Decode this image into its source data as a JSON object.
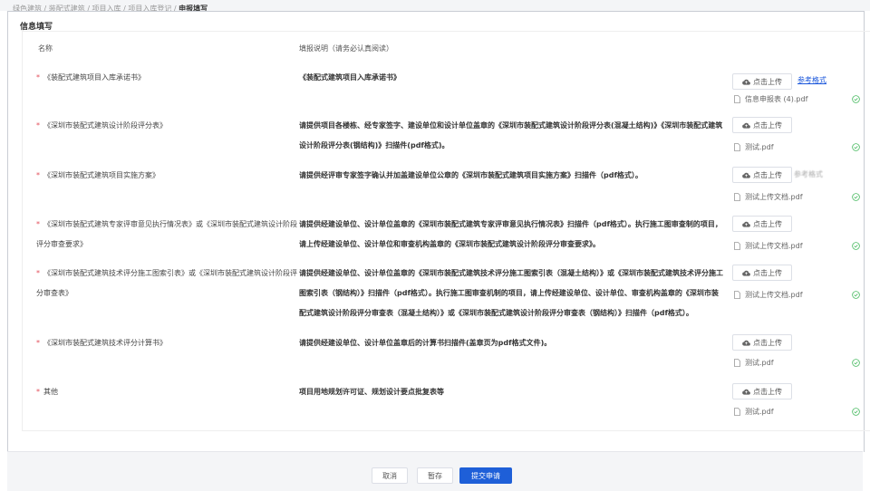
{
  "breadcrumb": {
    "path": "绿色建筑 / 装配式建筑 / 项目入库 / 项目入库登记 / ",
    "current": "申报填写"
  },
  "section_title": "信息填写",
  "table": {
    "headers": {
      "name": "名称",
      "desc": "填报说明（请务必认真阅读）"
    },
    "rows": [
      {
        "required": "*",
        "name": "《装配式建筑项目入库承诺书》",
        "desc": "《装配式建筑项目入库承诺书》",
        "upload_label": "点击上传",
        "link": "参考格式",
        "file": "信息申报表 (4).pdf"
      },
      {
        "required": "*",
        "name": "《深圳市装配式建筑设计阶段评分表》",
        "desc": "请提供项目各楼栋、经专家签字、建设单位和设计单位盖章的《深圳市装配式建筑设计阶段评分表(混凝土结构)》《深圳市装配式建筑设计阶段评分表(钢结构)》扫描件(pdf格式)。",
        "upload_label": "点击上传",
        "file": "测试.pdf"
      },
      {
        "required": "*",
        "name": "《深圳市装配式建筑项目实施方案》",
        "desc": "请提供经评审专家签字确认并加盖建设单位公章的《深圳市装配式建筑项目实施方案》扫描件（pdf格式）。",
        "upload_label": "点击上传",
        "link_blurred": "参考格式",
        "file": "测试上传文档.pdf"
      },
      {
        "required": "*",
        "name": "《深圳市装配式建筑专家评审意见执行情况表》或《深圳市装配式建筑设计阶段评分审查要求》",
        "desc": "请提供经建设单位、设计单位盖章的《深圳市装配式建筑专家评审意见执行情况表》扫描件（pdf格式）。执行施工图审查制的项目，请上传经建设单位、设计单位和审查机构盖章的《深圳市装配式建筑设计阶段评分审查要求》。",
        "upload_label": "点击上传",
        "file": "测试上传文档.pdf"
      },
      {
        "required": "*",
        "name": "《深圳市装配式建筑技术评分施工图索引表》或《深圳市装配式建筑设计阶段评分审查表》",
        "desc": "请提供经建设单位、设计单位盖章的《深圳市装配式建筑技术评分施工图索引表（混凝土结构）》或《深圳市装配式建筑技术评分施工图索引表（钢结构）》扫描件（pdf格式）。执行施工图审查机制的项目，请上传经建设单位、设计单位、审查机构盖章的《深圳市装配式建筑设计阶段评分审查表（混凝土结构）》或《深圳市装配式建筑设计阶段评分审查表（钢结构）》扫描件（pdf格式）。",
        "upload_label": "点击上传",
        "file": "测试上传文档.pdf"
      },
      {
        "required": "*",
        "name": "《深圳市装配式建筑技术评分计算书》",
        "desc": "请提供经建设单位、设计单位盖章后的计算书扫描件(盖章页为pdf格式文件)。",
        "upload_label": "点击上传",
        "file": "测试.pdf"
      },
      {
        "required": "*",
        "name": "其他",
        "desc": "项目用地规划许可证、规划设计要点批复表等",
        "upload_label": "点击上传",
        "file": "测试.pdf"
      }
    ]
  },
  "footer": {
    "cancel": "取消",
    "draft": "暂存",
    "submit": "提交申请"
  },
  "colors": {
    "primary": "#1e5fd8",
    "required": "#e34d59",
    "success": "#43b85c",
    "link": "#1a56db"
  }
}
